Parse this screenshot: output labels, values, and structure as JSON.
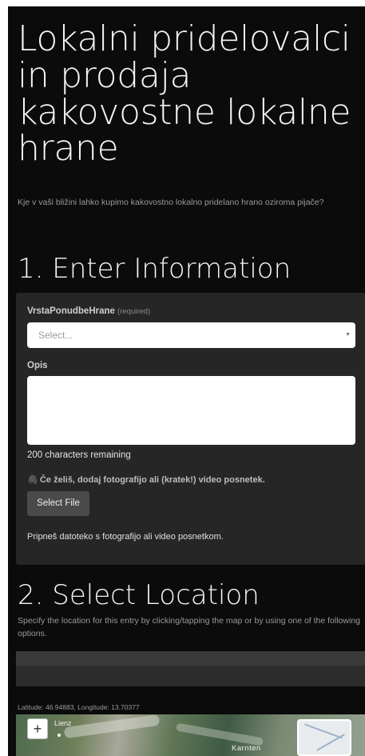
{
  "header": {
    "title": "Lokalni pridelovalci in prodaja kakovostne lokalne hrane",
    "subtitle": "Kje v vaši bližini lahko kupimo kakovostno lokalno pridelano hrano oziroma pijače?"
  },
  "section1": {
    "heading": "1. Enter Information",
    "fields": {
      "type_label": "VrstaPonudbeHrane",
      "type_required": "(required)",
      "type_placeholder": "Select...",
      "description_label": "Opis",
      "description_value": "",
      "chars_remaining": "200 characters remaining",
      "attachment_label": "Če želiš, dodaj fotografijo ali (kratek!) video posnetek.",
      "select_file_label": "Select File",
      "attachment_help": "Pripneš datoteko s fotografijo ali video posnetkom."
    }
  },
  "section2": {
    "heading": "2. Select Location",
    "description": "Specify the location for this entry by clicking/tapping the map or by using one of the following options.",
    "coordinates": "Latitude: 46.94883,  Longitude: 13.70377"
  },
  "map": {
    "zoom_in_label": "+",
    "place_labels": [
      "Lienz",
      "Karnten"
    ]
  },
  "icons": {
    "select_chevron": "chevron-down-icon",
    "attachment": "paperclip-icon",
    "zoom_in": "plus-icon",
    "basemap_toggle": "layers-icon"
  },
  "colors": {
    "background": "#0b0b0b",
    "card": "#262626",
    "button": "#4a4a4a",
    "muted_text": "#9a9a9a"
  }
}
